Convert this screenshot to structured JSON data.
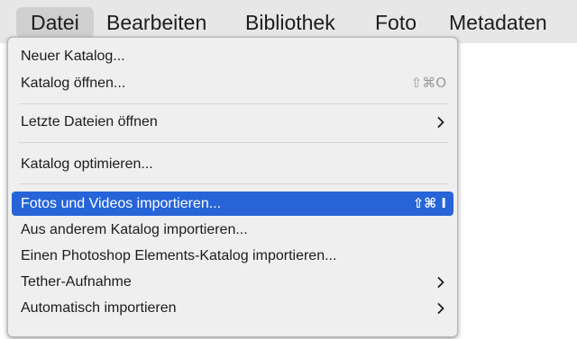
{
  "menubar": {
    "items": [
      {
        "label": "Datei",
        "active": true
      },
      {
        "label": "Bearbeiten",
        "active": false
      },
      {
        "label": "Bibliothek",
        "active": false
      },
      {
        "label": "Foto",
        "active": false
      },
      {
        "label": "Metadaten",
        "active": false
      }
    ]
  },
  "menu": {
    "items": [
      {
        "label": "Neuer Katalog..."
      },
      {
        "label": "Katalog öffnen...",
        "shortcut": "⇧⌘O"
      },
      {
        "label": "Letzte Dateien öffnen",
        "submenu": true
      },
      {
        "label": "Katalog optimieren..."
      },
      {
        "label": "Fotos und Videos importieren...",
        "shortcut": "⇧⌘ I",
        "highlighted": true
      },
      {
        "label": "Aus anderem Katalog importieren..."
      },
      {
        "label": "Einen Photoshop Elements-Katalog importieren..."
      },
      {
        "label": "Tether-Aufnahme",
        "submenu": true
      },
      {
        "label": "Automatisch importieren",
        "submenu": true
      }
    ]
  },
  "colors": {
    "highlight": "#2664d8",
    "menubar_bg": "#e7e7e7",
    "menu_bg": "#efefef"
  },
  "icons": {
    "submenu": "chevron-right-icon"
  }
}
